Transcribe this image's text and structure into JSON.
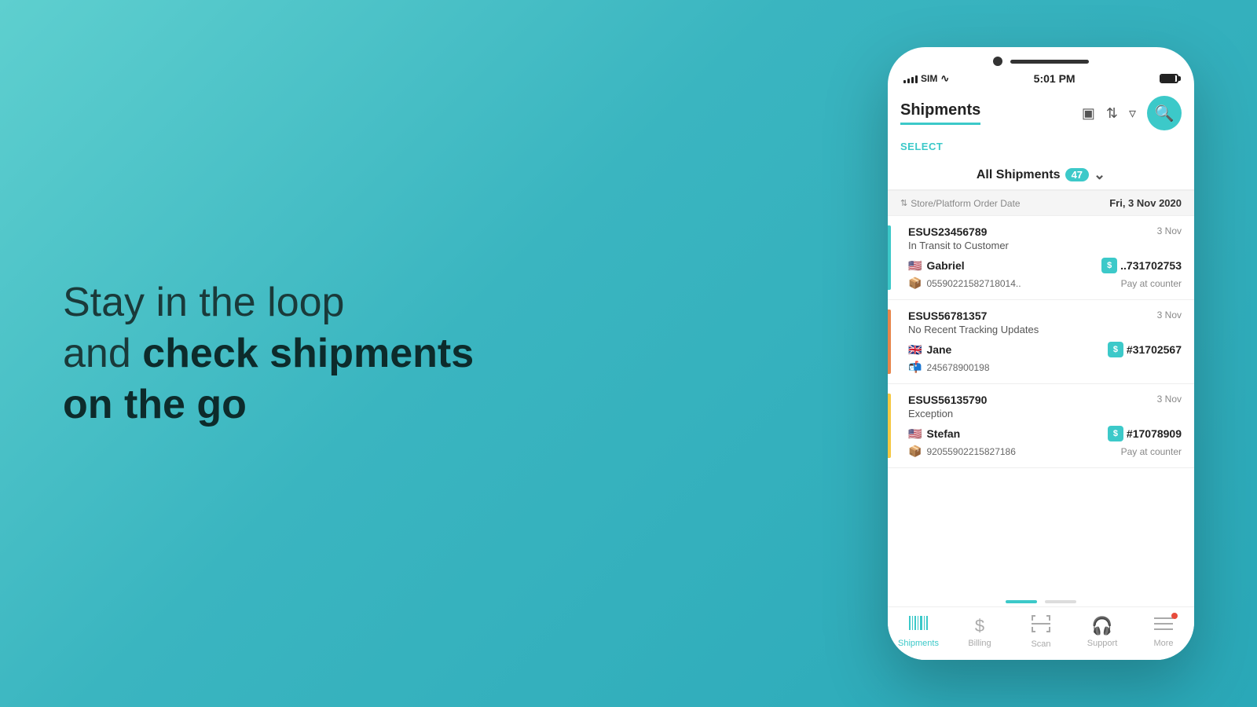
{
  "background": {
    "gradient_start": "#5ecfcf",
    "gradient_end": "#2aa8b8"
  },
  "left_panel": {
    "line1": "Stay in the loop",
    "line2_plain": "and ",
    "line2_bold": "check shipments",
    "line3_bold": "on the go"
  },
  "phone": {
    "status_bar": {
      "carrier": "SIM",
      "time": "5:01 PM",
      "battery_label": "Battery"
    },
    "header": {
      "title": "Shipments",
      "select_label": "SELECT"
    },
    "filter_row": {
      "label": "All Shipments",
      "count": "47"
    },
    "date_separator": {
      "sort_label": "Store/Platform Order Date",
      "date_value": "Fri, 3 Nov 2020"
    },
    "shipments": [
      {
        "tracking_id": "ESUS23456789",
        "date": "3 Nov",
        "status": "In Transit to Customer",
        "status_color": "blue",
        "customer_flag": "🇺🇸",
        "customer_name": "Gabriel",
        "order_ref": "..731702753",
        "carrier_icon": "📦",
        "carrier_tracking": "05590221582718014..",
        "payment": "Pay at counter"
      },
      {
        "tracking_id": "ESUS56781357",
        "date": "3 Nov",
        "status": "No Recent Tracking Updates",
        "status_color": "orange",
        "customer_flag": "🇬🇧",
        "customer_name": "Jane",
        "order_ref": "#31702567",
        "carrier_icon": "📬",
        "carrier_tracking": "245678900198",
        "payment": ""
      },
      {
        "tracking_id": "ESUS56135790",
        "date": "3 Nov",
        "status": "Exception",
        "status_color": "yellow",
        "customer_flag": "🇺🇸",
        "customer_name": "Stefan",
        "order_ref": "#17078909",
        "carrier_icon": "📦",
        "carrier_tracking": "92055902215827186",
        "payment": "Pay at counter"
      }
    ],
    "bottom_nav": {
      "items": [
        {
          "label": "Shipments",
          "icon": "barcode",
          "active": true
        },
        {
          "label": "Billing",
          "icon": "dollar",
          "active": false
        },
        {
          "label": "Scan",
          "icon": "scan",
          "active": false
        },
        {
          "label": "Support",
          "icon": "headset",
          "active": false
        },
        {
          "label": "More",
          "icon": "menu",
          "active": false,
          "badge": true
        }
      ]
    }
  }
}
